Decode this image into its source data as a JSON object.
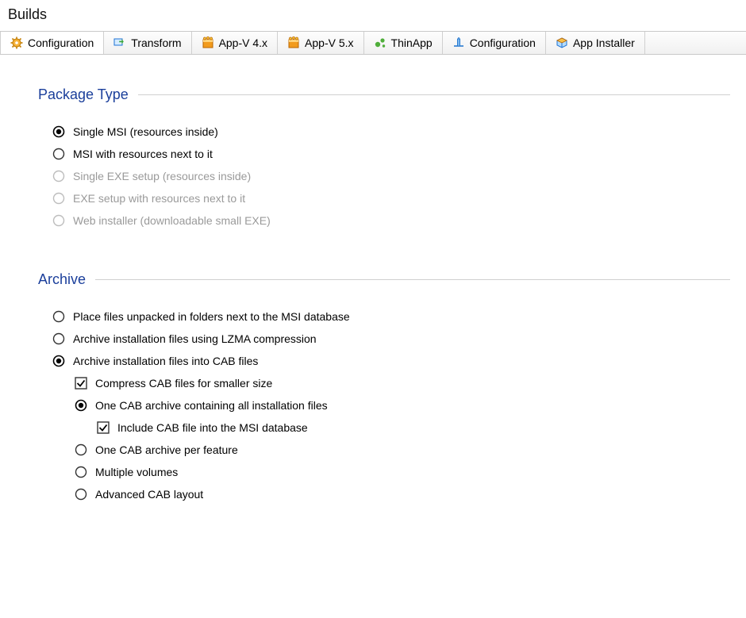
{
  "pageTitle": "Builds",
  "tabs": [
    {
      "id": "configuration",
      "label": "Configuration",
      "active": true,
      "icon": "gear"
    },
    {
      "id": "transform",
      "label": "Transform",
      "active": false,
      "icon": "transform"
    },
    {
      "id": "appv4",
      "label": "App-V 4.x",
      "active": false,
      "icon": "appv-orange"
    },
    {
      "id": "appv5",
      "label": "App-V 5.x",
      "active": false,
      "icon": "appv-orange"
    },
    {
      "id": "thinapp",
      "label": "ThinApp",
      "active": false,
      "icon": "thinapp"
    },
    {
      "id": "configuration2",
      "label": "Configuration",
      "active": false,
      "icon": "config-blue"
    },
    {
      "id": "appinstaller",
      "label": "App Installer",
      "active": false,
      "icon": "app-installer"
    }
  ],
  "sections": {
    "packageType": {
      "title": "Package Type",
      "options": [
        {
          "kind": "radio",
          "label": "Single MSI (resources inside)",
          "selected": true,
          "disabled": false
        },
        {
          "kind": "radio",
          "label": "MSI with resources next to it",
          "selected": false,
          "disabled": false
        },
        {
          "kind": "radio",
          "label": "Single EXE setup (resources inside)",
          "selected": false,
          "disabled": true
        },
        {
          "kind": "radio",
          "label": "EXE setup with resources next to it",
          "selected": false,
          "disabled": true
        },
        {
          "kind": "radio",
          "label": "Web installer (downloadable small EXE)",
          "selected": false,
          "disabled": true
        }
      ]
    },
    "archive": {
      "title": "Archive",
      "options": [
        {
          "kind": "radio",
          "label": "Place files unpacked in folders next to the MSI database",
          "selected": false,
          "indent": 0
        },
        {
          "kind": "radio",
          "label": "Archive installation files using LZMA compression",
          "selected": false,
          "indent": 0
        },
        {
          "kind": "radio",
          "label": "Archive installation files into CAB files",
          "selected": true,
          "indent": 0
        },
        {
          "kind": "checkbox",
          "label": "Compress CAB files for smaller size",
          "selected": true,
          "indent": 1
        },
        {
          "kind": "radio",
          "label": "One CAB archive containing all installation files",
          "selected": true,
          "indent": 1
        },
        {
          "kind": "checkbox",
          "label": "Include CAB file into the MSI database",
          "selected": true,
          "indent": 2
        },
        {
          "kind": "radio",
          "label": "One CAB archive per feature",
          "selected": false,
          "indent": 1
        },
        {
          "kind": "radio",
          "label": "Multiple volumes",
          "selected": false,
          "indent": 1
        },
        {
          "kind": "radio",
          "label": "Advanced CAB layout",
          "selected": false,
          "indent": 1
        }
      ]
    }
  }
}
